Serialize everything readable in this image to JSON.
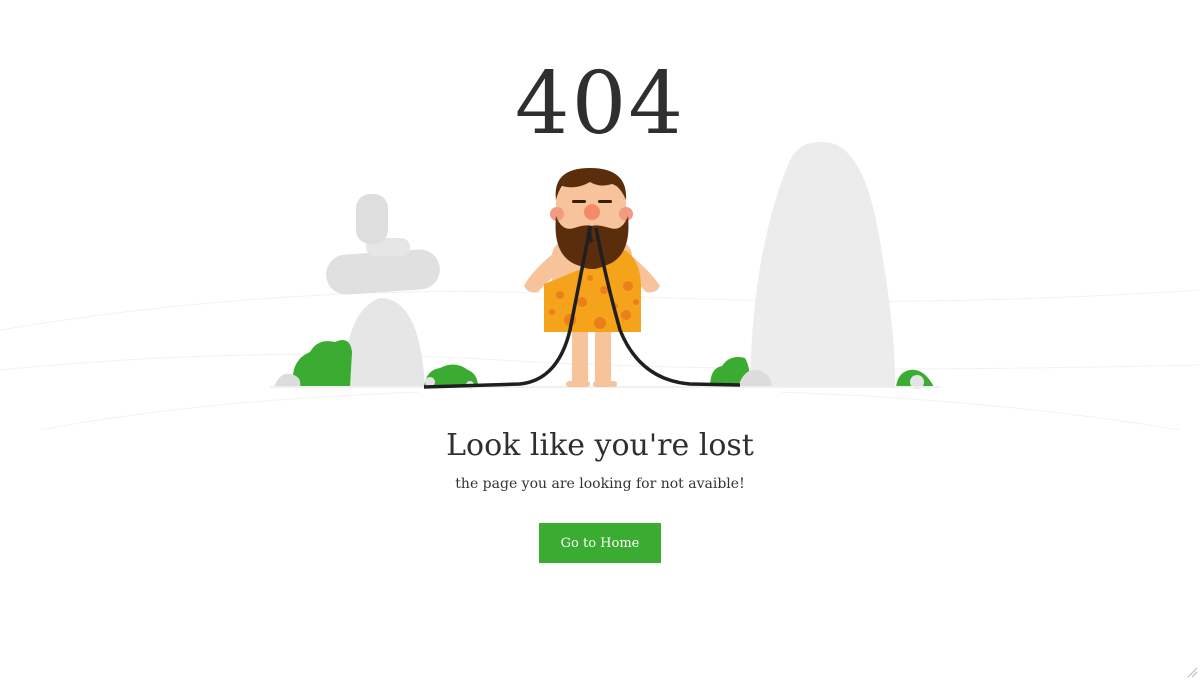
{
  "error": {
    "code": "404",
    "heading": "Look like you're lost",
    "message": "the page you are looking for not avaible!"
  },
  "actions": {
    "home_label": "Go to Home"
  },
  "colors": {
    "accent_green": "#39ac31",
    "text_dark": "#2f2f2f",
    "rock_grey": "#e3e3e3",
    "tunic_orange": "#f5a31a",
    "beard_brown": "#5a2d0c"
  }
}
